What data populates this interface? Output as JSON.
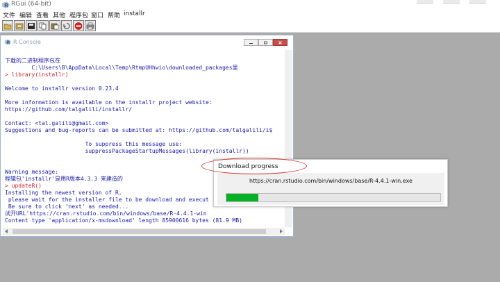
{
  "app": {
    "title": "RGui (64-bit)"
  },
  "menu": [
    "文件",
    "编辑",
    "查看",
    "其他",
    "程序包",
    "窗口",
    "帮助",
    "installr"
  ],
  "toolbar": {
    "buttons": [
      "open-script-icon",
      "load-workspace-icon",
      "save-workspace-icon",
      "copy-icon",
      "paste-icon",
      "copy-paste-icon",
      "stop-icon",
      "print-icon"
    ],
    "stop_color": "#e0201d"
  },
  "console": {
    "title": "R Console",
    "lines": [
      {
        "text": "下载的二进制程序包在",
        "style": "output"
      },
      {
        "text": "        C:\\Users\\B\\AppData\\Local\\Temp\\RtmpUHhwio\\downloaded_packages里",
        "style": "output"
      },
      {
        "text": "> library(installr)",
        "style": "input"
      },
      {
        "text": "",
        "style": "output"
      },
      {
        "text": "Welcome to installr version 0.23.4",
        "style": "output"
      },
      {
        "text": "",
        "style": "output"
      },
      {
        "text": "More information is available on the installr project website:",
        "style": "output"
      },
      {
        "text": "https://github.com/talgalili/installr/",
        "style": "output"
      },
      {
        "text": "",
        "style": "output"
      },
      {
        "text": "Contact: <tal.galili@gmail.com>",
        "style": "output"
      },
      {
        "text": "Suggestions and bug-reports can be submitted at: https://github.com/talgalili/i$",
        "style": "output"
      },
      {
        "text": "",
        "style": "output"
      },
      {
        "text": "                        To suppress this message use:",
        "style": "output"
      },
      {
        "text": "                        suppressPackageStartupMessages(library(installr))",
        "style": "output"
      },
      {
        "text": "",
        "style": "output"
      },
      {
        "text": "",
        "style": "output"
      },
      {
        "text": "Warning message:",
        "style": "output"
      },
      {
        "text": "程辑包'installr'是用R版本4.3.3 来建造的",
        "style": "output"
      },
      {
        "text": "> updateR()",
        "style": "input"
      },
      {
        "text": "Installing the newest version of R,",
        "style": "output"
      },
      {
        "text": " please wait for the installer file to be download and execut",
        "style": "output"
      },
      {
        "text": " Be sure to click 'next' as needed...",
        "style": "output"
      },
      {
        "text": "试开URL'https://cran.rstudio.com/bin/windows/base/R-4.4.1-win",
        "style": "output"
      },
      {
        "text": "Content type 'application/x-msdownload' length 85900616 bytes (81.9 MB)",
        "style": "output"
      }
    ],
    "colors": {
      "output": "#1a1aa8",
      "input": "#d8222a"
    }
  },
  "download": {
    "title": "Download progress",
    "url": "https://cran.rstudio.com/bin/windows/base/R-4.4.1-win.exe",
    "progress": 0.15,
    "progress_color": "#06b025"
  },
  "annotation_color": "#d9362b"
}
